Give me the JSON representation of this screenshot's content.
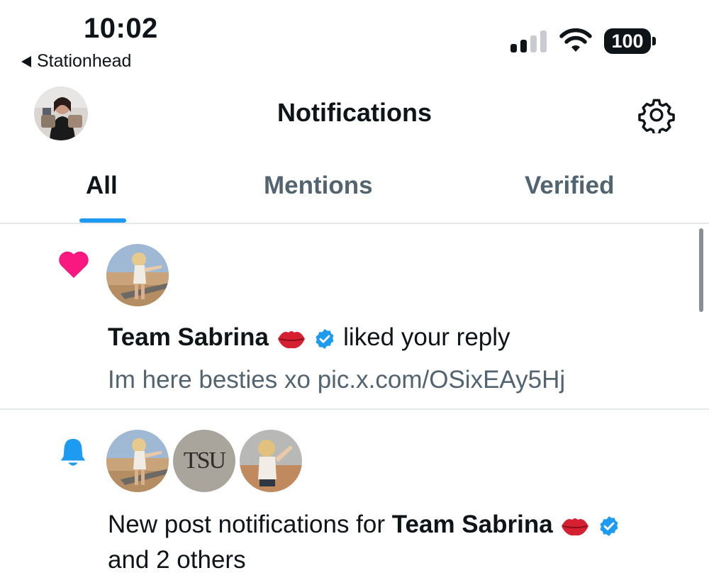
{
  "status_bar": {
    "time": "10:02",
    "back_app": "Stationhead",
    "battery": "100"
  },
  "header": {
    "title": "Notifications"
  },
  "tabs": [
    {
      "label": "All",
      "active": true
    },
    {
      "label": "Mentions",
      "active": false
    },
    {
      "label": "Verified",
      "active": false
    }
  ],
  "notifications": [
    {
      "type_icon": "heart-icon",
      "name": "Team Sabrina",
      "action": "liked your reply",
      "post_text": "Im here besties xo pic.x.com/OSixEAy5Hj"
    },
    {
      "type_icon": "bell-icon",
      "prefix": "New post notifications for",
      "name": "Team Sabrina",
      "suffix": "and 2 others",
      "avatar_2_text": "TSU"
    }
  ],
  "colors": {
    "accent": "#1d9bf0",
    "heart": "#f91880",
    "verified": "#1d9bf0",
    "secondary_text": "#536471"
  }
}
